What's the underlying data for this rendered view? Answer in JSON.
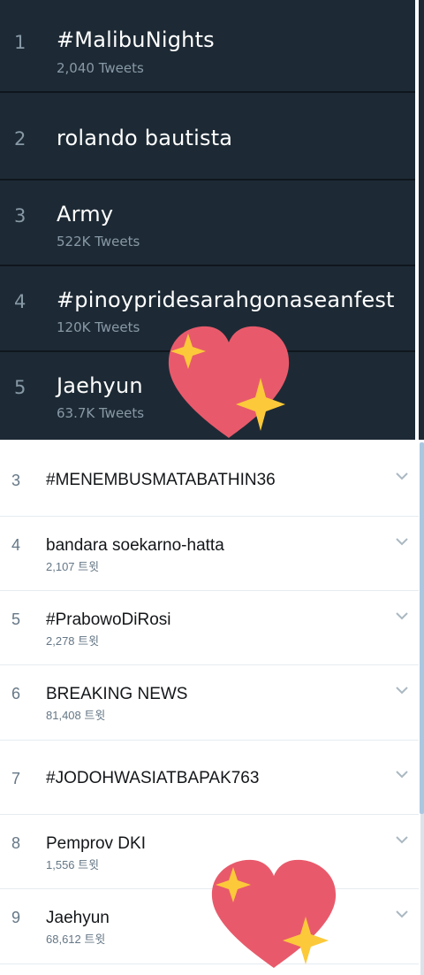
{
  "dark_trends": [
    {
      "rank": "1",
      "name": "#MalibuNights",
      "count": "2,040 Tweets"
    },
    {
      "rank": "2",
      "name": "rolando bautista",
      "count": ""
    },
    {
      "rank": "3",
      "name": "Army",
      "count": "522K Tweets"
    },
    {
      "rank": "4",
      "name": "#pinoypridesarahgonaseanfest",
      "count": "120K Tweets"
    },
    {
      "rank": "5",
      "name": "Jaehyun",
      "count": "63.7K Tweets"
    }
  ],
  "light_trends": [
    {
      "rank": "3",
      "name": "#MENEMBUSMATABATHIN36",
      "count": ""
    },
    {
      "rank": "4",
      "name": "bandara soekarno-hatta",
      "count": "2,107 트윗"
    },
    {
      "rank": "5",
      "name": "#PrabowoDiRosi",
      "count": "2,278 트윗"
    },
    {
      "rank": "6",
      "name": "BREAKING NEWS",
      "count": "81,408 트윗"
    },
    {
      "rank": "7",
      "name": "#JODOHWASIATBAPAK763",
      "count": ""
    },
    {
      "rank": "8",
      "name": "Pemprov DKI",
      "count": "1,556 트윗"
    },
    {
      "rank": "9",
      "name": "Jaehyun",
      "count": "68,612 트윗"
    }
  ],
  "stickers": [
    {
      "icon": "sparkling-heart-icon",
      "heart_color": "#e85a6b",
      "sparkle_color": "#fcc93a"
    },
    {
      "icon": "sparkling-heart-icon",
      "heart_color": "#e85a6b",
      "sparkle_color": "#fcc93a"
    }
  ]
}
